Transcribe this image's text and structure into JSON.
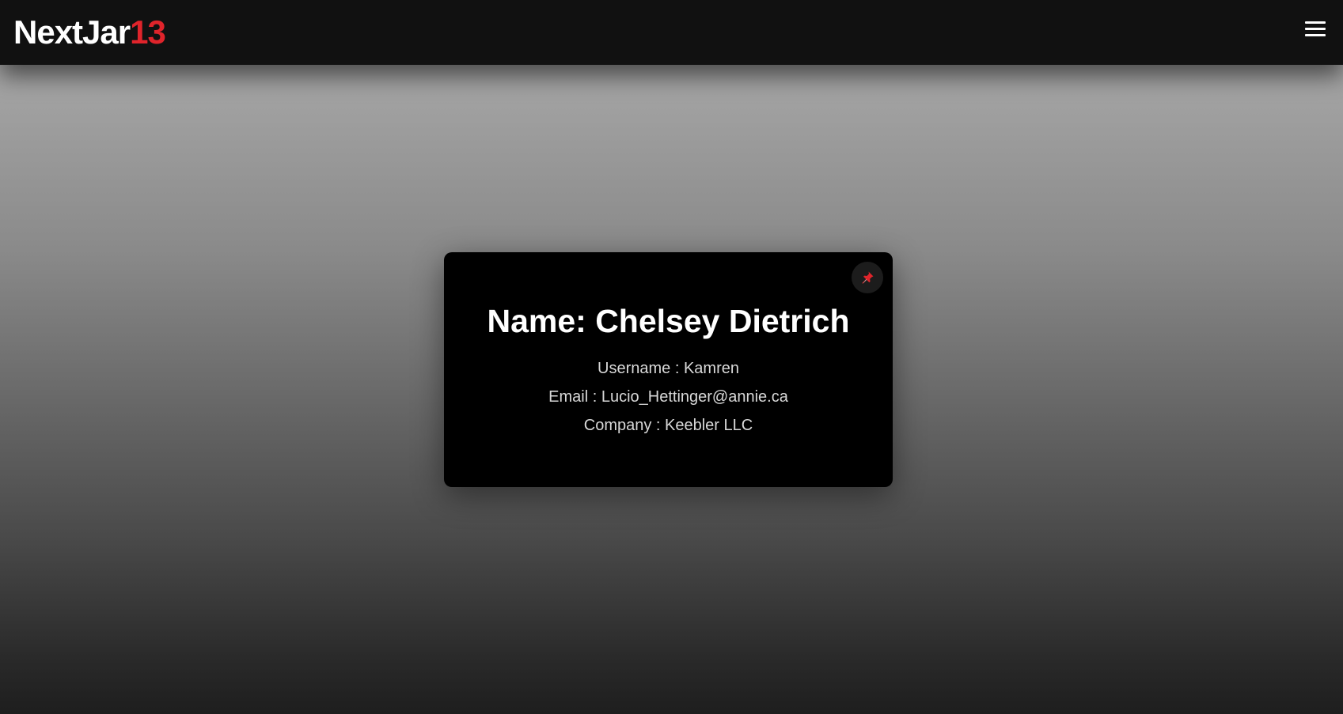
{
  "navbar": {
    "brand_text": "NextJar",
    "brand_accent": "13",
    "menu_icon": "hamburger-menu-icon"
  },
  "card": {
    "name": "Name: Chelsey Dietrich",
    "username": "Username : Kamren",
    "email": "Email : Lucio_Hettinger@annie.ca",
    "company": "Company : Keebler LLC",
    "pin_icon": "pin-icon"
  },
  "colors": {
    "navbar_bg": "#111111",
    "accent": "#e0242b",
    "card_bg": "#000000"
  }
}
